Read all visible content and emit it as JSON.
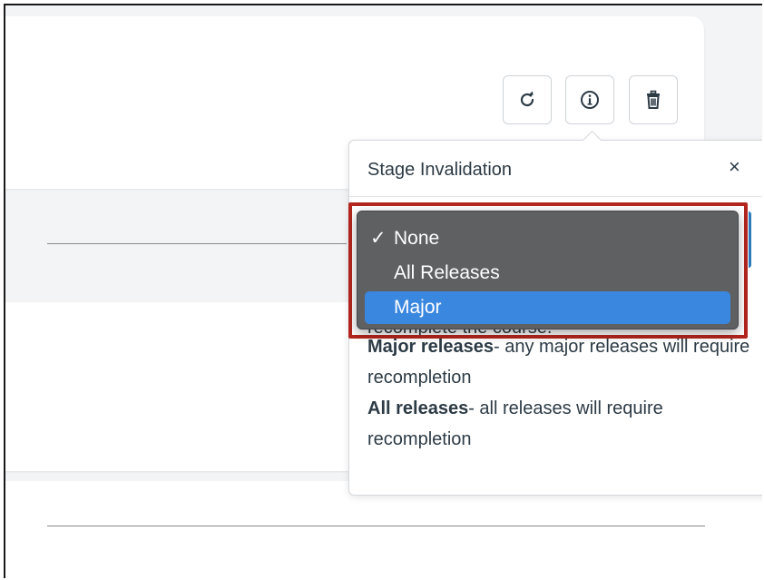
{
  "toolbar": {
    "refresh_icon": "refresh-icon",
    "info_icon": "info-icon",
    "delete_icon": "trash-icon"
  },
  "popover": {
    "title": "Stage Invalidation",
    "close_label": "×",
    "body_cut_line": "recomplete the course.",
    "definitions": [
      {
        "term": "Major releases",
        "text": "- any major releases will require recompletion"
      },
      {
        "term": "All releases",
        "text": "- all releases will require recompletion"
      }
    ]
  },
  "dropdown": {
    "selected": "None",
    "highlighted": "Major",
    "options": [
      {
        "label": "None",
        "check": "✓"
      },
      {
        "label": "All Releases",
        "check": ""
      },
      {
        "label": "Major",
        "check": ""
      }
    ]
  },
  "colors": {
    "highlight_border": "#b3261e",
    "menu_background": "#5f6062",
    "menu_selection": "#3a87e0"
  }
}
